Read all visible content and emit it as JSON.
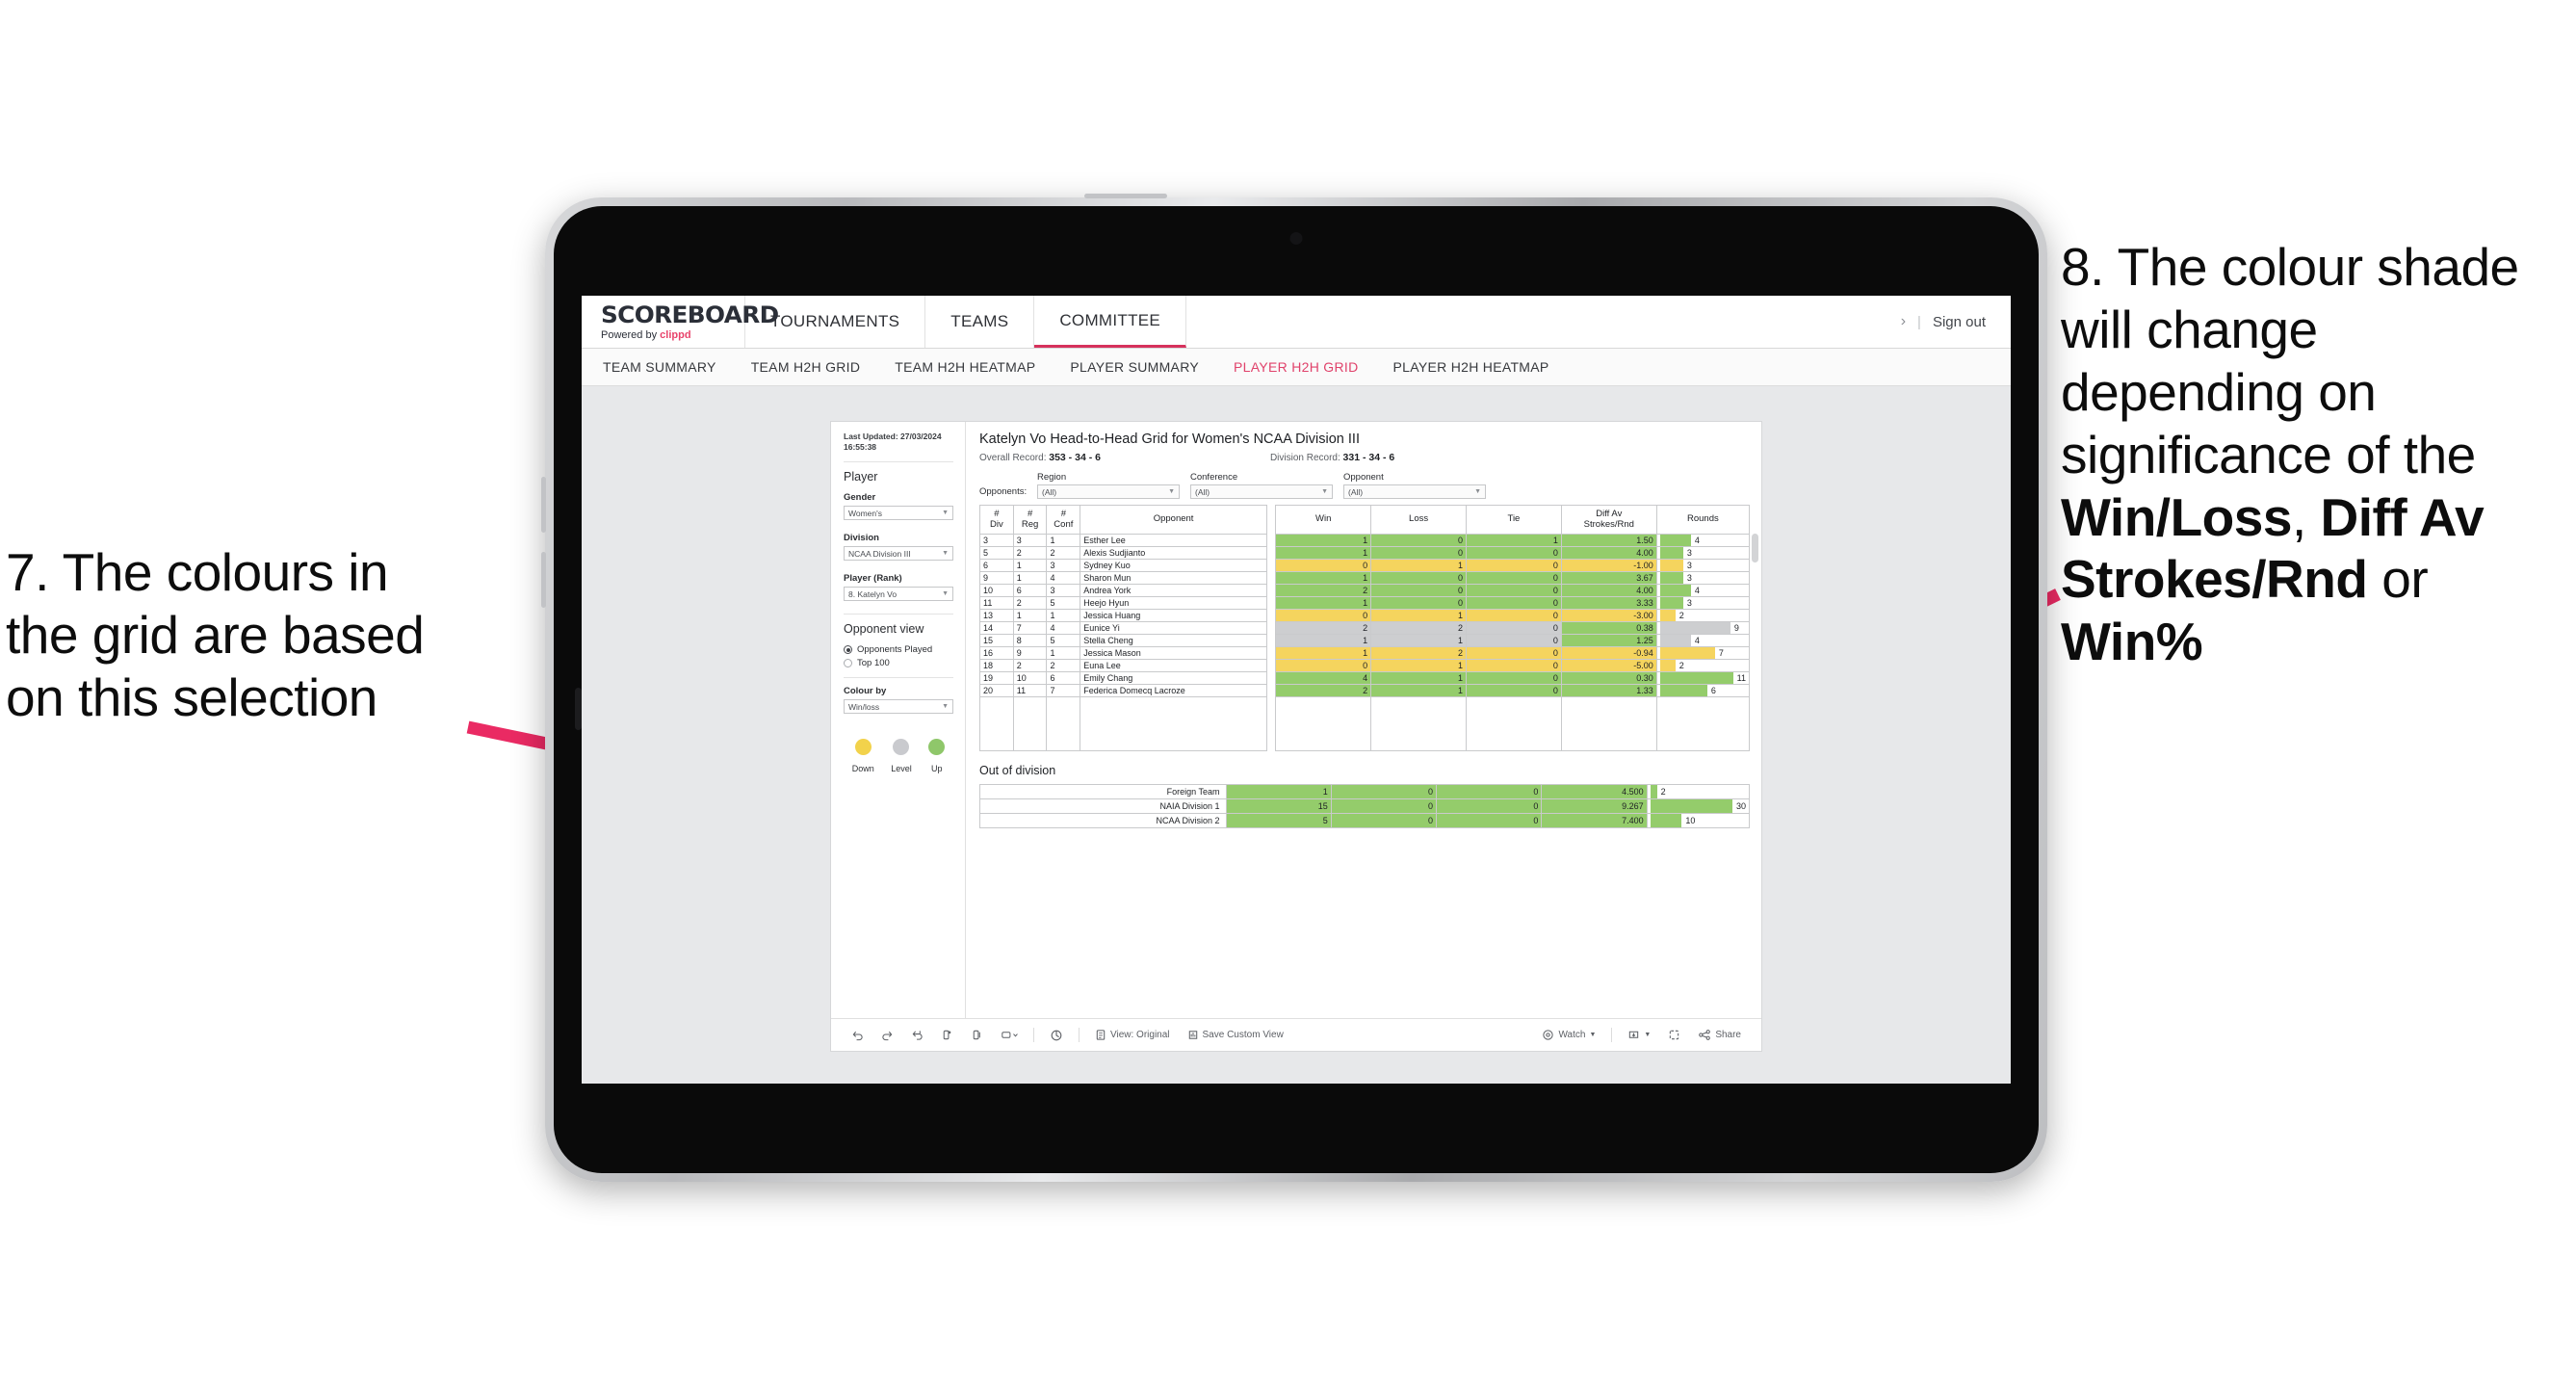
{
  "annotations": {
    "left": {
      "lines": [
        "7. The colours in",
        "the grid are based",
        "on this selection"
      ]
    },
    "right": {
      "pre": "8. The colour shade will change depending on significance of the ",
      "bold1": "Win/Loss",
      "mid1": ", ",
      "bold2": "Diff Av Strokes/Rnd",
      "mid2": " or ",
      "bold3": "Win%"
    },
    "arrow_color": "#ea2a63"
  },
  "app": {
    "brand": {
      "name": "SCOREBOARD",
      "powered_by": "Powered by ",
      "clippd": "clippd"
    },
    "top_nav": [
      {
        "label": "TOURNAMENTS",
        "active": false
      },
      {
        "label": "TEAMS",
        "active": false
      },
      {
        "label": "COMMITTEE",
        "active": true
      }
    ],
    "top_right": {
      "chevron": "›",
      "separator": "|",
      "sign_out": "Sign out"
    },
    "sub_nav": [
      {
        "label": "TEAM SUMMARY",
        "active": false
      },
      {
        "label": "TEAM H2H GRID",
        "active": false
      },
      {
        "label": "TEAM H2H HEATMAP",
        "active": false
      },
      {
        "label": "PLAYER SUMMARY",
        "active": false
      },
      {
        "label": "PLAYER H2H GRID",
        "active": true
      },
      {
        "label": "PLAYER H2H HEATMAP",
        "active": false
      }
    ]
  },
  "sidebar": {
    "last_updated": "Last Updated: 27/03/2024 16:55:38",
    "section_player": "Player",
    "gender": {
      "label": "Gender",
      "value": "Women's"
    },
    "division": {
      "label": "Division",
      "value": "NCAA Division III"
    },
    "player_rank": {
      "label": "Player (Rank)",
      "value": "8. Katelyn Vo"
    },
    "opponent_view": {
      "label": "Opponent view",
      "options": [
        {
          "label": "Opponents Played",
          "selected": true
        },
        {
          "label": "Top 100",
          "selected": false
        }
      ]
    },
    "colour_by": {
      "label": "Colour by",
      "value": "Win/loss"
    },
    "legend": [
      {
        "label": "Down",
        "color": "#f2d24b"
      },
      {
        "label": "Level",
        "color": "#c9cace"
      },
      {
        "label": "Up",
        "color": "#8fc76a"
      }
    ]
  },
  "main": {
    "title": "Katelyn Vo Head-to-Head Grid for Women's NCAA Division III",
    "overall_record_label": "Overall Record: ",
    "overall_record_value": "353 -  34 - 6",
    "division_record_label": "Division Record: ",
    "division_record_value": "331 -  34 - 6",
    "opponents_label": "Opponents:",
    "filters": [
      {
        "caption": "Region",
        "value": "(All)"
      },
      {
        "caption": "Conference",
        "value": "(All)"
      },
      {
        "caption": "Opponent",
        "value": "(All)"
      }
    ],
    "columns": [
      "# Div",
      "# Reg",
      "# Conf",
      "Opponent",
      "Win",
      "Loss",
      "Tie",
      "Diff Av Strokes/Rnd",
      "Rounds"
    ],
    "column_lines": [
      [
        "#",
        "Div"
      ],
      [
        "#",
        "Reg"
      ],
      [
        "#",
        "Conf"
      ],
      [
        "Opponent",
        ""
      ],
      [
        "Win",
        ""
      ],
      [
        "Loss",
        ""
      ],
      [
        "Tie",
        ""
      ],
      [
        "Diff Av",
        "Strokes/Rnd"
      ],
      [
        "Rounds",
        ""
      ]
    ],
    "rows": [
      {
        "div": "3",
        "reg": "3",
        "conf": "1",
        "opponent": "Esther Lee",
        "win": "1",
        "loss": "0",
        "tie": "1",
        "diff": "1.50",
        "rounds": "4",
        "color": "green"
      },
      {
        "div": "5",
        "reg": "2",
        "conf": "2",
        "opponent": "Alexis Sudjianto",
        "win": "1",
        "loss": "0",
        "tie": "0",
        "diff": "4.00",
        "rounds": "3",
        "color": "green"
      },
      {
        "div": "6",
        "reg": "1",
        "conf": "3",
        "opponent": "Sydney Kuo",
        "win": "0",
        "loss": "1",
        "tie": "0",
        "diff": "-1.00",
        "rounds": "3",
        "color": "yellow"
      },
      {
        "div": "9",
        "reg": "1",
        "conf": "4",
        "opponent": "Sharon Mun",
        "win": "1",
        "loss": "0",
        "tie": "0",
        "diff": "3.67",
        "rounds": "3",
        "color": "green"
      },
      {
        "div": "10",
        "reg": "6",
        "conf": "3",
        "opponent": "Andrea York",
        "win": "2",
        "loss": "0",
        "tie": "0",
        "diff": "4.00",
        "rounds": "4",
        "color": "green"
      },
      {
        "div": "11",
        "reg": "2",
        "conf": "5",
        "opponent": "Heejo Hyun",
        "win": "1",
        "loss": "0",
        "tie": "0",
        "diff": "3.33",
        "rounds": "3",
        "color": "green"
      },
      {
        "div": "13",
        "reg": "1",
        "conf": "1",
        "opponent": "Jessica Huang",
        "win": "0",
        "loss": "1",
        "tie": "0",
        "diff": "-3.00",
        "rounds": "2",
        "color": "yellow"
      },
      {
        "div": "14",
        "reg": "7",
        "conf": "4",
        "opponent": "Eunice Yi",
        "win": "2",
        "loss": "2",
        "tie": "0",
        "diff": "0.38",
        "rounds": "9",
        "color": "grey",
        "diff_color": "green"
      },
      {
        "div": "15",
        "reg": "8",
        "conf": "5",
        "opponent": "Stella Cheng",
        "win": "1",
        "loss": "1",
        "tie": "0",
        "diff": "1.25",
        "rounds": "4",
        "color": "grey",
        "diff_color": "green"
      },
      {
        "div": "16",
        "reg": "9",
        "conf": "1",
        "opponent": "Jessica Mason",
        "win": "1",
        "loss": "2",
        "tie": "0",
        "diff": "-0.94",
        "rounds": "7",
        "color": "yellow"
      },
      {
        "div": "18",
        "reg": "2",
        "conf": "2",
        "opponent": "Euna Lee",
        "win": "0",
        "loss": "1",
        "tie": "0",
        "diff": "-5.00",
        "rounds": "2",
        "color": "yellow"
      },
      {
        "div": "19",
        "reg": "10",
        "conf": "6",
        "opponent": "Emily Chang",
        "win": "4",
        "loss": "1",
        "tie": "0",
        "diff": "0.30",
        "rounds": "11",
        "color": "green"
      },
      {
        "div": "20",
        "reg": "11",
        "conf": "7",
        "opponent": "Federica Domecq Lacroze",
        "win": "2",
        "loss": "1",
        "tie": "0",
        "diff": "1.33",
        "rounds": "6",
        "color": "green"
      }
    ],
    "out_of_division": {
      "title": "Out of division",
      "rows": [
        {
          "name": "Foreign Team",
          "win": "1",
          "loss": "0",
          "tie": "0",
          "diff": "4.500",
          "rounds": "2",
          "color": "green"
        },
        {
          "name": "NAIA Division 1",
          "win": "15",
          "loss": "0",
          "tie": "0",
          "diff": "9.267",
          "rounds": "30",
          "color": "green"
        },
        {
          "name": "NCAA Division 2",
          "win": "5",
          "loss": "0",
          "tie": "0",
          "diff": "7.400",
          "rounds": "10",
          "color": "green"
        }
      ]
    }
  },
  "toolbar": {
    "undo": "undo-icon",
    "redo": "redo-icon",
    "revert": "revert-icon",
    "refresh": "refresh-icon",
    "pause": "pause-icon",
    "device": "device-icon",
    "view_original": "View: Original",
    "save_custom_view": "Save Custom View",
    "watch": "Watch",
    "share": "Share"
  },
  "colors": {
    "accent_pink": "#e0426b",
    "green": "#94cc6b",
    "yellow": "#f5d45e",
    "grey": "#cdced0"
  }
}
